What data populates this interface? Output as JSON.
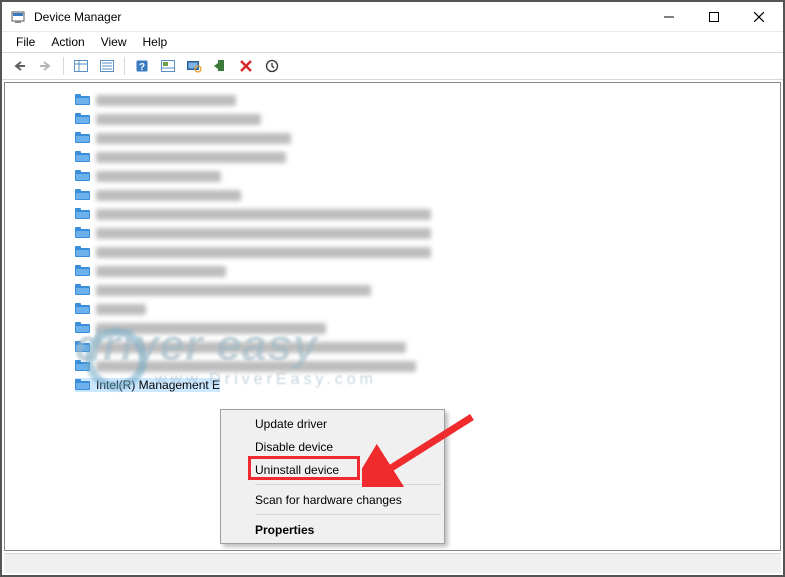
{
  "window": {
    "title": "Device Manager"
  },
  "menu": {
    "file": "File",
    "action": "Action",
    "view": "View",
    "help": "Help"
  },
  "toolbar_icons": [
    "back",
    "forward",
    "show-hide-tree",
    "properties",
    "help",
    "update-driver",
    "scan-hardware",
    "add-legacy",
    "uninstall",
    "enable-device"
  ],
  "tree": {
    "blurred_widths": [
      140,
      165,
      195,
      190,
      125,
      145,
      335,
      335,
      335,
      130,
      275,
      50,
      230,
      310,
      320
    ],
    "selected_label": "Intel(R) Management E"
  },
  "context_menu": {
    "items": [
      {
        "key": "update",
        "label": "Update driver"
      },
      {
        "key": "disable",
        "label": "Disable device"
      },
      {
        "key": "uninstall",
        "label": "Uninstall device",
        "highlighted": true
      },
      {
        "sep": true
      },
      {
        "key": "scan",
        "label": "Scan for hardware changes"
      },
      {
        "sep": true
      },
      {
        "key": "props",
        "label": "Properties",
        "bold": true
      }
    ]
  },
  "watermark": {
    "line1": "driver easy",
    "line2": "www.DriverEasy.com"
  },
  "annotation": {
    "highlight_color": "#ef2b2e"
  }
}
